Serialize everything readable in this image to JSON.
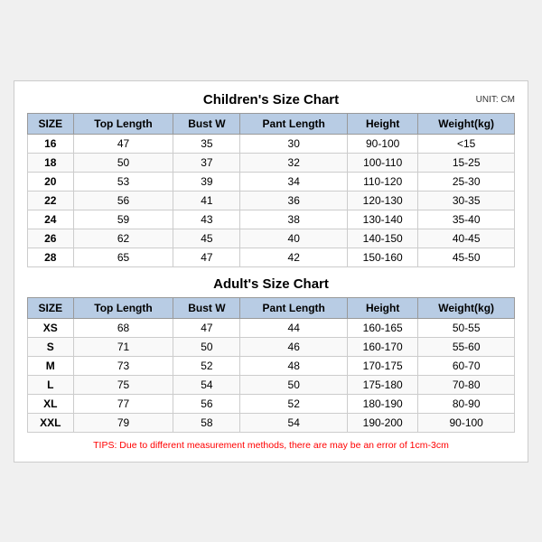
{
  "children_chart": {
    "title": "Children's Size Chart",
    "unit": "UNIT: CM",
    "headers": [
      "SIZE",
      "Top Length",
      "Bust W",
      "Pant Length",
      "Height",
      "Weight(kg)"
    ],
    "rows": [
      [
        "16",
        "47",
        "35",
        "30",
        "90-100",
        "<15"
      ],
      [
        "18",
        "50",
        "37",
        "32",
        "100-110",
        "15-25"
      ],
      [
        "20",
        "53",
        "39",
        "34",
        "110-120",
        "25-30"
      ],
      [
        "22",
        "56",
        "41",
        "36",
        "120-130",
        "30-35"
      ],
      [
        "24",
        "59",
        "43",
        "38",
        "130-140",
        "35-40"
      ],
      [
        "26",
        "62",
        "45",
        "40",
        "140-150",
        "40-45"
      ],
      [
        "28",
        "65",
        "47",
        "42",
        "150-160",
        "45-50"
      ]
    ]
  },
  "adults_chart": {
    "title": "Adult's Size Chart",
    "headers": [
      "SIZE",
      "Top Length",
      "Bust W",
      "Pant Length",
      "Height",
      "Weight(kg)"
    ],
    "rows": [
      [
        "XS",
        "68",
        "47",
        "44",
        "160-165",
        "50-55"
      ],
      [
        "S",
        "71",
        "50",
        "46",
        "160-170",
        "55-60"
      ],
      [
        "M",
        "73",
        "52",
        "48",
        "170-175",
        "60-70"
      ],
      [
        "L",
        "75",
        "54",
        "50",
        "175-180",
        "70-80"
      ],
      [
        "XL",
        "77",
        "56",
        "52",
        "180-190",
        "80-90"
      ],
      [
        "XXL",
        "79",
        "58",
        "54",
        "190-200",
        "90-100"
      ]
    ]
  },
  "tips": "TIPS: Due to different measurement methods, there are may be an error of 1cm-3cm"
}
